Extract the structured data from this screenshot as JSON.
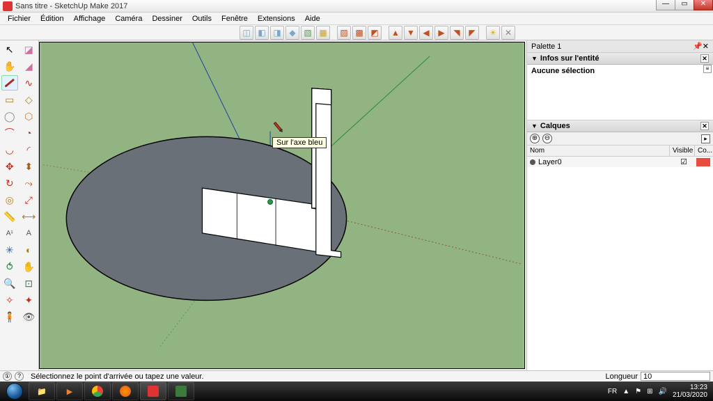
{
  "window": {
    "title": "Sans titre - SketchUp Make 2017",
    "min": "—",
    "max": "▭",
    "close": "✕"
  },
  "menu": {
    "items": [
      "Fichier",
      "Édition",
      "Affichage",
      "Caméra",
      "Dessiner",
      "Outils",
      "Fenêtre",
      "Extensions",
      "Aide"
    ]
  },
  "viewport": {
    "tooltip": "Sur l'axe bleu"
  },
  "right": {
    "palette": "Palette 1",
    "entity_header": "Infos sur l'entité",
    "entity_empty": "Aucune sélection",
    "layers_header": "Calques",
    "layers_cols": {
      "name": "Nom",
      "visible": "Visible",
      "color": "Co..."
    },
    "layer0": {
      "name": "Layer0",
      "visible": true,
      "color": "#e74c3c"
    },
    "plus": "⊕",
    "minus": "⊖",
    "menu": "▸"
  },
  "status": {
    "message": "Sélectionnez le point d'arrivée ou tapez une valeur.",
    "length_label": "Longueur",
    "length_value": "10",
    "icon1": "①",
    "icon2": "?"
  },
  "taskbar": {
    "lang": "FR",
    "time": "13:23",
    "date": "21/03/2020"
  }
}
